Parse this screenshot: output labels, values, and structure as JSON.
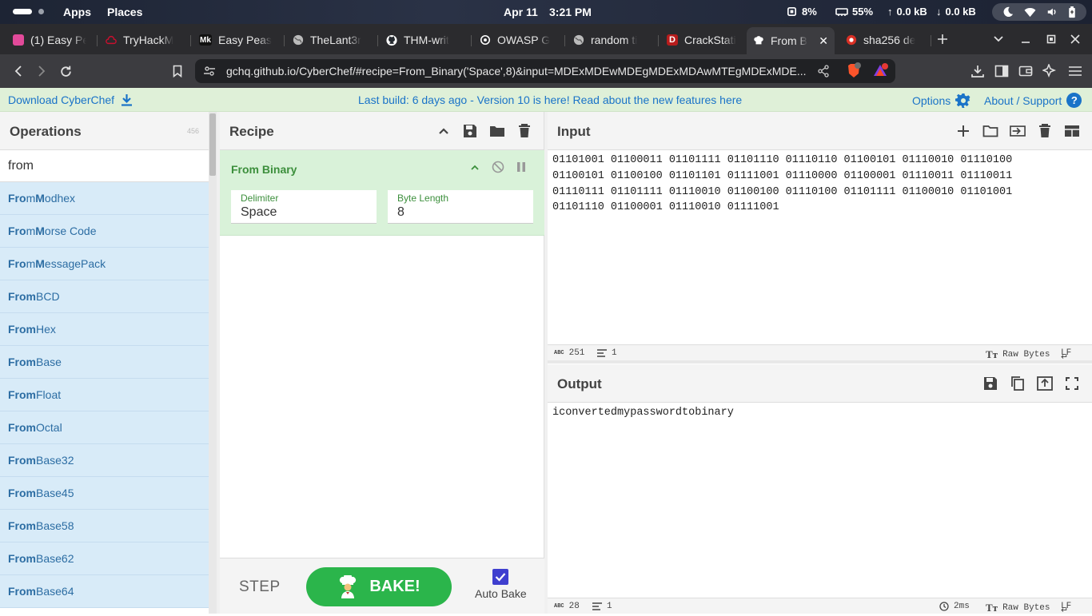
{
  "topbar": {
    "apps": "Apps",
    "places": "Places",
    "date": "Apr 11",
    "time": "3:21 PM",
    "cpu": "8%",
    "mem": "55%",
    "up": "0.0 kB",
    "down": "0.0 kB"
  },
  "tabs": [
    {
      "label": "(1) Easy Pe",
      "color": "#e24a9a"
    },
    {
      "label": "TryHackM",
      "color": "#c8102e"
    },
    {
      "label": "Easy Peas",
      "color": "#111111",
      "glyph": "Mk"
    },
    {
      "label": "TheLant3r",
      "color": "#5f6368"
    },
    {
      "label": "THM-writ",
      "color": "#24292f"
    },
    {
      "label": "OWASP G",
      "color": "#333333"
    },
    {
      "label": "random ti",
      "color": "#5f6368"
    },
    {
      "label": "CrackStati",
      "color": "#b71c1c",
      "glyph": "D"
    },
    {
      "label": "From B",
      "color": "#ffffff"
    },
    {
      "label": "sha256 de",
      "color": "#d93025"
    }
  ],
  "address": {
    "url": "gchq.github.io/CyberChef/#recipe=From_Binary('Space',8)&input=MDExMDEwMDEgMDExMDAwMTEgMDExMDE..."
  },
  "banner": {
    "download": "Download CyberChef",
    "build": "Last build: 6 days ago - Version 10 is here! Read about the new features here",
    "options": "Options",
    "about": "About / Support"
  },
  "operations": {
    "title": "Operations",
    "count": "456",
    "search_value": "from",
    "items": [
      {
        "html": "<b>Fro</b>m <b>M</b>odhex"
      },
      {
        "html": "<b>Fro</b>m <b>M</b>orse Code"
      },
      {
        "html": "<b>Fro</b>m <b>M</b>essagePack"
      },
      {
        "html": "<b>From</b> BCD"
      },
      {
        "html": "<b>From</b> Hex"
      },
      {
        "html": "<b>From</b> Base"
      },
      {
        "html": "<b>From</b> Float"
      },
      {
        "html": "<b>From</b> Octal"
      },
      {
        "html": "<b>From</b> Base32"
      },
      {
        "html": "<b>From</b> Base45"
      },
      {
        "html": "<b>From</b> Base58"
      },
      {
        "html": "<b>From</b> Base62"
      },
      {
        "html": "<b>From</b> Base64"
      }
    ]
  },
  "recipe": {
    "title": "Recipe",
    "operation": "From Binary",
    "delimiter_label": "Delimiter",
    "delimiter_value": "Space",
    "bytelen_label": "Byte Length",
    "bytelen_value": "8",
    "step": "STEP",
    "bake": "BAKE!",
    "autobake": "Auto Bake"
  },
  "input": {
    "title": "Input",
    "lines": [
      "01101001 01100011 01101111 01101110 01110110 01100101 01110010 01110100",
      "01100101 01100100 01101101 01111001 01110000 01100001 01110011 01110011",
      "01110111 01101111 01110010 01100100 01110100 01101111 01100010 01101001",
      "01101110 01100001 01110010 01111001"
    ],
    "length": "251",
    "lines_count": "1",
    "encoding": "Raw Bytes",
    "eol": "LF"
  },
  "output": {
    "title": "Output",
    "text": "iconvertedmypasswordtobinary",
    "length": "28",
    "lines_count": "1",
    "time": "2ms",
    "encoding": "Raw Bytes",
    "eol": "LF"
  }
}
